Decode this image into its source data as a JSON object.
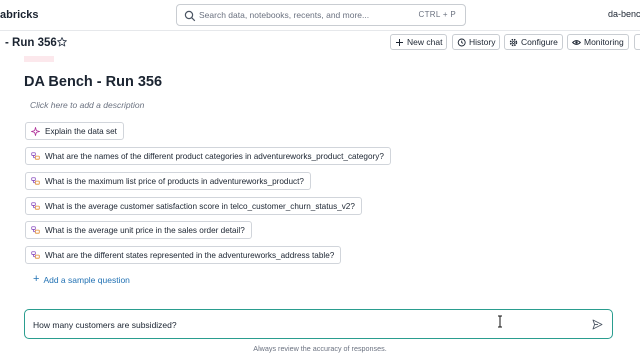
{
  "topbar": {
    "brand": "abricks",
    "search_placeholder": "Search data, notebooks, recents, and more...",
    "search_shortcut": "CTRL + P",
    "workspace": "da-bench"
  },
  "header": {
    "title": "- Run 356",
    "buttons": {
      "new_chat": "New chat",
      "history": "History",
      "configure": "Configure",
      "monitoring": "Monitoring"
    }
  },
  "main": {
    "title": "DA Bench - Run 356",
    "description_placeholder": "Click here to add a description",
    "explain_label": "Explain the data set",
    "sample_questions": [
      "What are the names of the different product categories in adventureworks_product_category?",
      "What is the maximum list price of products in adventureworks_product?",
      "What is the average customer satisfaction score in telco_customer_churn_status_v2?",
      "What is the average unit price in the sales order detail?",
      "What are the different states represented in the adventureworks_address table?"
    ],
    "add_sample_label": "Add a sample question"
  },
  "chat": {
    "input_value": "How many customers are subsidized?",
    "disclaimer": "Always review the accuracy of responses."
  },
  "colors": {
    "accent_link": "#2272b4",
    "input_border": "#2a9d8f",
    "sparkle": "#b0329a",
    "icon_purple": "#8a4fbf",
    "icon_orange": "#e0892b"
  },
  "icons": {
    "search": "search-icon",
    "star": "star-icon",
    "new_chat": "plus-icon",
    "history": "history-icon",
    "configure": "gear-icon",
    "monitoring": "eye-icon",
    "explain": "sparkle-icon",
    "question": "sample-question-icon",
    "send": "send-icon"
  }
}
